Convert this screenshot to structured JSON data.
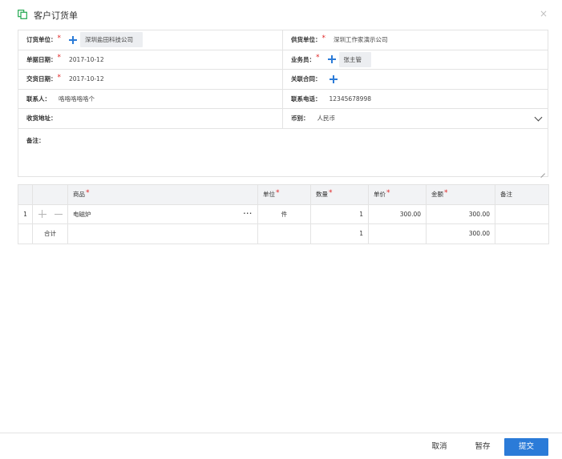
{
  "dialog": {
    "title": "客户订货单",
    "close": "×"
  },
  "form": {
    "order_unit": {
      "label": "订货单位：",
      "value": "深圳盐田科技公司"
    },
    "supplier": {
      "label": "供货单位：",
      "value": "深圳工作家演示公司"
    },
    "doc_date": {
      "label": "单据日期：",
      "value": "2017-10-12"
    },
    "salesman": {
      "label": "业务员：",
      "value": "张主管"
    },
    "delivery_date": {
      "label": "交货日期：",
      "value": "2017-10-12"
    },
    "contract": {
      "label": "关联合同："
    },
    "contact": {
      "label": "联系人：",
      "value": "咯咯咯咯咯个"
    },
    "phone": {
      "label": "联系电话：",
      "value": "12345678998"
    },
    "address": {
      "label": "收货地址：",
      "value": ""
    },
    "currency": {
      "label": "币别：",
      "value": "人民币"
    },
    "remark": {
      "label": "备注：",
      "value": ""
    },
    "required_mark": "*"
  },
  "table": {
    "headers": {
      "product": "商品",
      "unit": "单位",
      "qty": "数量",
      "price": "单价",
      "amount": "金额",
      "note": "备注"
    },
    "rows": [
      {
        "index": "1",
        "product": "电磁炉",
        "more": "···",
        "unit": "件",
        "qty": "1",
        "price": "300.00",
        "amount": "300.00",
        "note": ""
      }
    ],
    "total": {
      "label": "合计",
      "qty": "1",
      "amount": "300.00"
    }
  },
  "footer": {
    "cancel": "取消",
    "save": "暂存",
    "submit": "提交"
  },
  "colors": {
    "accent": "#2b7bd8",
    "required": "#e02424",
    "title_icon": "#20a84f"
  }
}
